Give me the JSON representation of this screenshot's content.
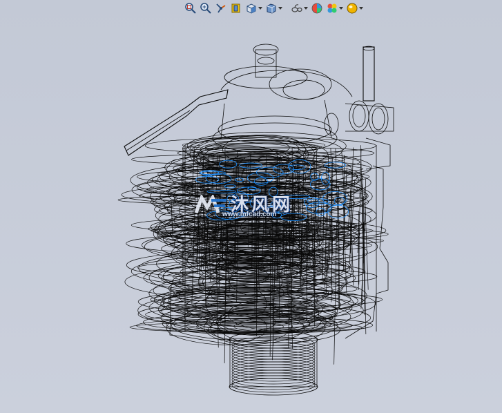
{
  "toolbar": {
    "items": [
      {
        "icon": "zoom-to-fit-icon",
        "has_dropdown": false
      },
      {
        "icon": "zoom-to-area-icon",
        "has_dropdown": false
      },
      {
        "icon": "previous-view-icon",
        "has_dropdown": false
      },
      {
        "icon": "section-view-icon",
        "has_dropdown": false
      },
      {
        "icon": "view-orientation-icon",
        "has_dropdown": true
      },
      {
        "icon": "display-style-icon",
        "has_dropdown": true
      },
      {
        "icon": "hide-show-items-icon",
        "has_dropdown": true
      },
      {
        "icon": "edit-appearance-icon",
        "has_dropdown": false
      },
      {
        "icon": "apply-scene-icon",
        "has_dropdown": true
      },
      {
        "icon": "view-settings-icon",
        "has_dropdown": true
      }
    ]
  },
  "model": {
    "render_mode": "wireframe",
    "line_color": "#0a0a0a",
    "highlight_color": "#1e90ff",
    "background_color": "#c6ccd8"
  },
  "watermark": {
    "cn_text": "沐风网",
    "url_text": "www.mfcad.com"
  }
}
